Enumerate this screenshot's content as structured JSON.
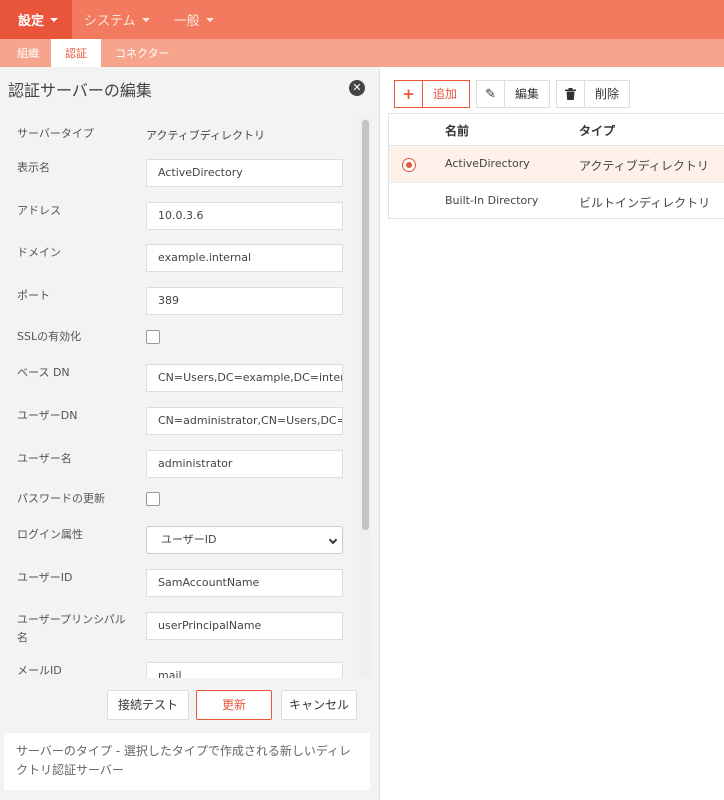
{
  "topnav": {
    "items": [
      {
        "label": "設定",
        "active": true
      },
      {
        "label": "システム",
        "active": false
      },
      {
        "label": "一般",
        "active": false
      }
    ]
  },
  "subnav": {
    "tabs": [
      {
        "label": "組織",
        "active": false
      },
      {
        "label": "認証",
        "active": true
      },
      {
        "label": "コネクター",
        "active": false
      }
    ]
  },
  "panel": {
    "title": "認証サーバーの編集",
    "close_icon": "close-circle-icon"
  },
  "form": {
    "server_type": {
      "label": "サーバータイプ",
      "value": "アクティブディレクトリ"
    },
    "display_name": {
      "label": "表示名",
      "value": "ActiveDirectory"
    },
    "address": {
      "label": "アドレス",
      "value": "10.0.3.6"
    },
    "domain": {
      "label": "ドメイン",
      "value": "example.internal"
    },
    "port": {
      "label": "ポート",
      "value": "389"
    },
    "ssl": {
      "label": "SSLの有効化",
      "checked": false
    },
    "base_dn": {
      "label": "ベース DN",
      "value": "CN=Users,DC=example,DC=interna"
    },
    "user_dn": {
      "label": "ユーザーDN",
      "value": "CN=administrator,CN=Users,DC=ex"
    },
    "username": {
      "label": "ユーザー名",
      "value": "administrator"
    },
    "password_update": {
      "label": "パスワードの更新",
      "checked": false
    },
    "login_attr": {
      "label": "ログイン属性",
      "value": "ユーザーID"
    },
    "user_id": {
      "label": "ユーザーID",
      "value": "SamAccountName"
    },
    "upn": {
      "label": "ユーザープリンシパル名",
      "value": "userPrincipalName"
    },
    "mail_id": {
      "label": "メールID",
      "value": "mail"
    }
  },
  "buttons": {
    "test": "接続テスト",
    "update": "更新",
    "cancel": "キャンセル"
  },
  "help": {
    "text": "サーバーのタイプ - 選択したタイプで作成される新しいディレクトリ認証サーバー"
  },
  "toolbar": {
    "add_label": "追加",
    "edit_label": "編集",
    "delete_label": "削除",
    "add_icon": "plus-icon",
    "edit_icon": "pencil-icon",
    "delete_icon": "trash-icon"
  },
  "table": {
    "columns": [
      "名前",
      "タイプ"
    ],
    "rows": [
      {
        "name": "ActiveDirectory",
        "type": "アクティブディレクトリ",
        "selected": true
      },
      {
        "name": "Built-In Directory",
        "type": "ビルトインディレクトリ",
        "selected": false
      }
    ]
  },
  "colors": {
    "accent": "#e8553a",
    "nav": "#f27a5e",
    "subnav": "#f7a48c"
  }
}
